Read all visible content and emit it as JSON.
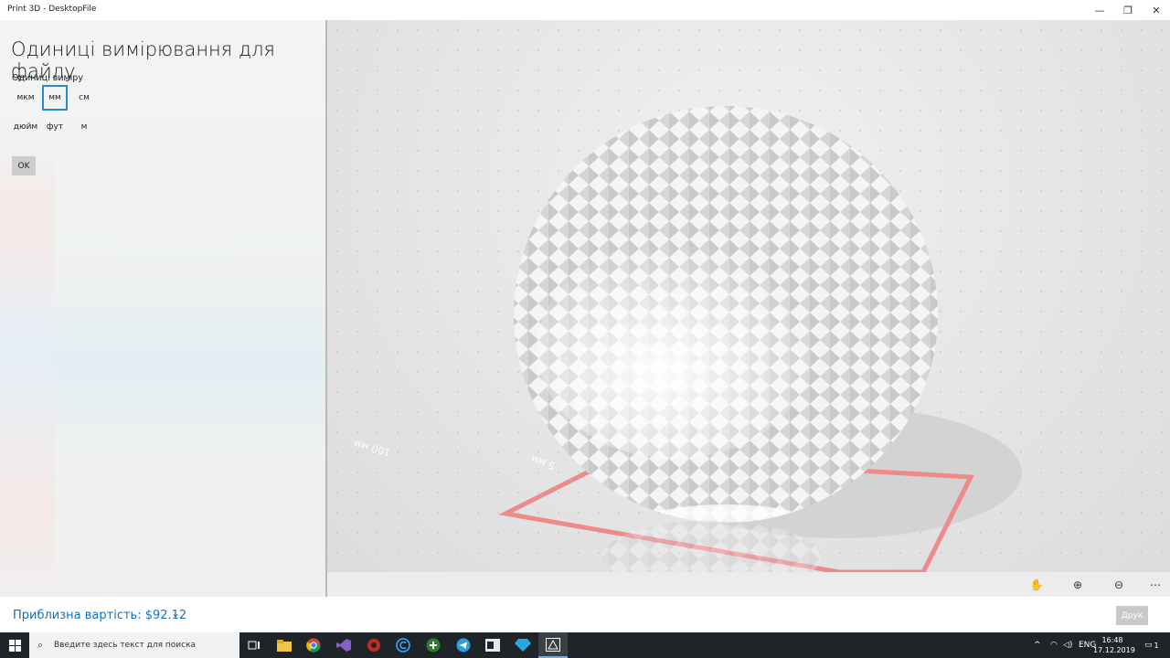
{
  "window": {
    "title": "Print 3D - DesktopFile"
  },
  "panel": {
    "title": "Одиниці вимірювання для файлу",
    "units_label": "Одиниці виміру",
    "units": [
      "мкм",
      "мм",
      "см",
      "дюйм",
      "фут",
      "м"
    ],
    "selected_unit": "мм",
    "ok_label": "OK"
  },
  "viewport": {
    "ruler_label_1": "100 мм",
    "ruler_label_2": "5 мм"
  },
  "bottom": {
    "cost_label": "Приблизна вартість: $92.12",
    "print_label": "Друк"
  },
  "taskbar": {
    "search_placeholder": "Введите здесь текст для поиска",
    "language": "ENG",
    "time": "16:48",
    "date": "17.12.2019",
    "notification_count": "1"
  },
  "colors": {
    "accent": "#2a8bd1",
    "cost": "#1a6fb5",
    "plate": "#e57373"
  }
}
